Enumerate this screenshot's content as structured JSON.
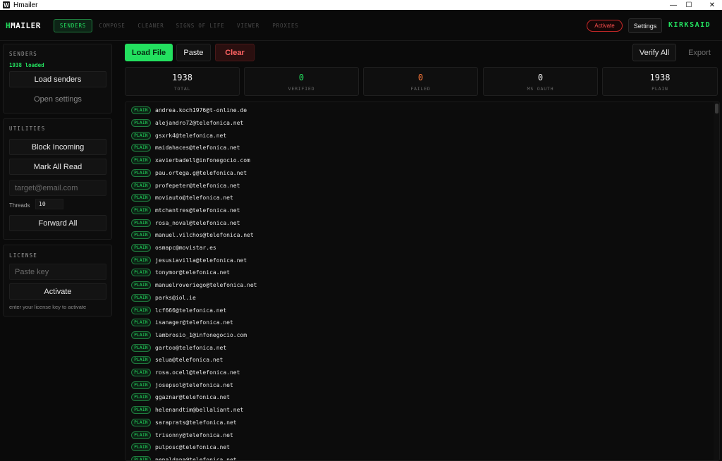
{
  "window": {
    "title": "Hmailer",
    "app_icon": "W",
    "minimize": "—",
    "maximize": "☐",
    "close": "✕"
  },
  "header": {
    "brand_prefix": "H",
    "brand_rest": "MAILER",
    "tabs": [
      {
        "label": "SENDERS",
        "active": true
      },
      {
        "label": "COMPOSE",
        "active": false
      },
      {
        "label": "CLEANER",
        "active": false
      },
      {
        "label": "SIGNS OF LIFE",
        "active": false
      },
      {
        "label": "VIEWER",
        "active": false
      },
      {
        "label": "PROXIES",
        "active": false
      }
    ],
    "activate_label": "Activate",
    "settings_label": "Settings",
    "user_name": "KIRKSAID"
  },
  "sidebar": {
    "senders": {
      "title": "SENDERS",
      "status": "1938 loaded",
      "load_label": "Load senders",
      "open_settings_label": "Open settings"
    },
    "utilities": {
      "title": "UTILITIES",
      "block_label": "Block Incoming",
      "mark_read_label": "Mark All Read",
      "target_placeholder": "target@email.com",
      "threads_label": "Threads",
      "threads_value": "10",
      "forward_label": "Forward All"
    },
    "license": {
      "title": "LICENSE",
      "key_placeholder": "Paste key",
      "activate_label": "Activate",
      "hint": "enter your license key to activate"
    }
  },
  "toolbar": {
    "load_file": "Load File",
    "paste": "Paste",
    "clear": "Clear",
    "verify_all": "Verify All",
    "export": "Export"
  },
  "stats": [
    {
      "value": "1938",
      "label": "TOTAL",
      "color": "#f2f2f2"
    },
    {
      "value": "0",
      "label": "VERIFIED",
      "color": "#23e05f"
    },
    {
      "value": "0",
      "label": "FAILED",
      "color": "#ff7a3a"
    },
    {
      "value": "0",
      "label": "MS OAUTH",
      "color": "#f2f2f2"
    },
    {
      "value": "1938",
      "label": "PLAIN",
      "color": "#f2f2f2"
    }
  ],
  "list": {
    "badge": "PLAIN",
    "emails": [
      "andrea.koch1976@t-online.de",
      "alejandro72@telefonica.net",
      "gsxrk4@telefonica.net",
      "maidahaces@telefonica.net",
      "xavierbadell@infonegocio.com",
      "pau.ortega.g@telefonica.net",
      "profepeter@telefonica.net",
      "moviauto@telefonica.net",
      "mtchantres@telefonica.net",
      "rosa_noval@telefonica.net",
      "manuel.vilchos@telefonica.net",
      "osmapc@movistar.es",
      "jesusiavilla@telefonica.net",
      "tonymor@telefonica.net",
      "manuelroveriego@telefonica.net",
      "parks@iol.ie",
      "lcf666@telefonica.net",
      "isanager@telefonica.net",
      "lambrosio_1@infonegocio.com",
      "gartoo@telefonica.net",
      "selua@telefonica.net",
      "rosa.ocell@telefonica.net",
      "josepsol@telefonica.net",
      "ggaznar@telefonica.net",
      "helenandtim@bellaliant.net",
      "saraprats@telefonica.net",
      "trisonny@telefonica.net",
      "pulposc@telefonica.net",
      "pepaldana@telefonica.net"
    ]
  }
}
